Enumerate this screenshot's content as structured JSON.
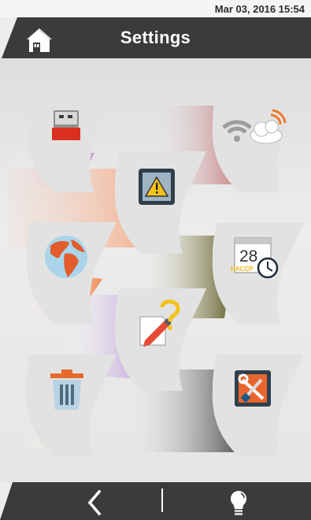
{
  "status": {
    "datetime": "Mar 03, 2016  15:54"
  },
  "header": {
    "title": "Settings",
    "home_icon": "home-icon"
  },
  "tiles": [
    {
      "name": "usb",
      "icon": "usb-drive-icon",
      "accent": "#c79ad8"
    },
    {
      "name": "network",
      "icon": "wifi-cloud-icon",
      "accent": "#b01c1c"
    },
    {
      "name": "alarms",
      "icon": "warning-icon",
      "accent": "#f6a983"
    },
    {
      "name": "language",
      "icon": "globe-icon",
      "accent": "#f38a55"
    },
    {
      "name": "date-time",
      "icon": "calendar-clock-icon",
      "calendar_day": "28",
      "calendar_caption": "HACCP",
      "accent": "#59561d"
    },
    {
      "name": "help",
      "icon": "edit-question-icon",
      "accent": "#9a66c9"
    },
    {
      "name": "delete",
      "icon": "trash-icon",
      "accent": "#e3e06a"
    },
    {
      "name": "service",
      "icon": "tools-icon",
      "accent": "#4f4f4f"
    }
  ],
  "footer": {
    "back_icon": "chevron-left-icon",
    "light_icon": "lightbulb-icon"
  },
  "colors": {
    "bar": "#3b3b3b",
    "bar_text": "#ffffff",
    "background": "#ececec"
  }
}
